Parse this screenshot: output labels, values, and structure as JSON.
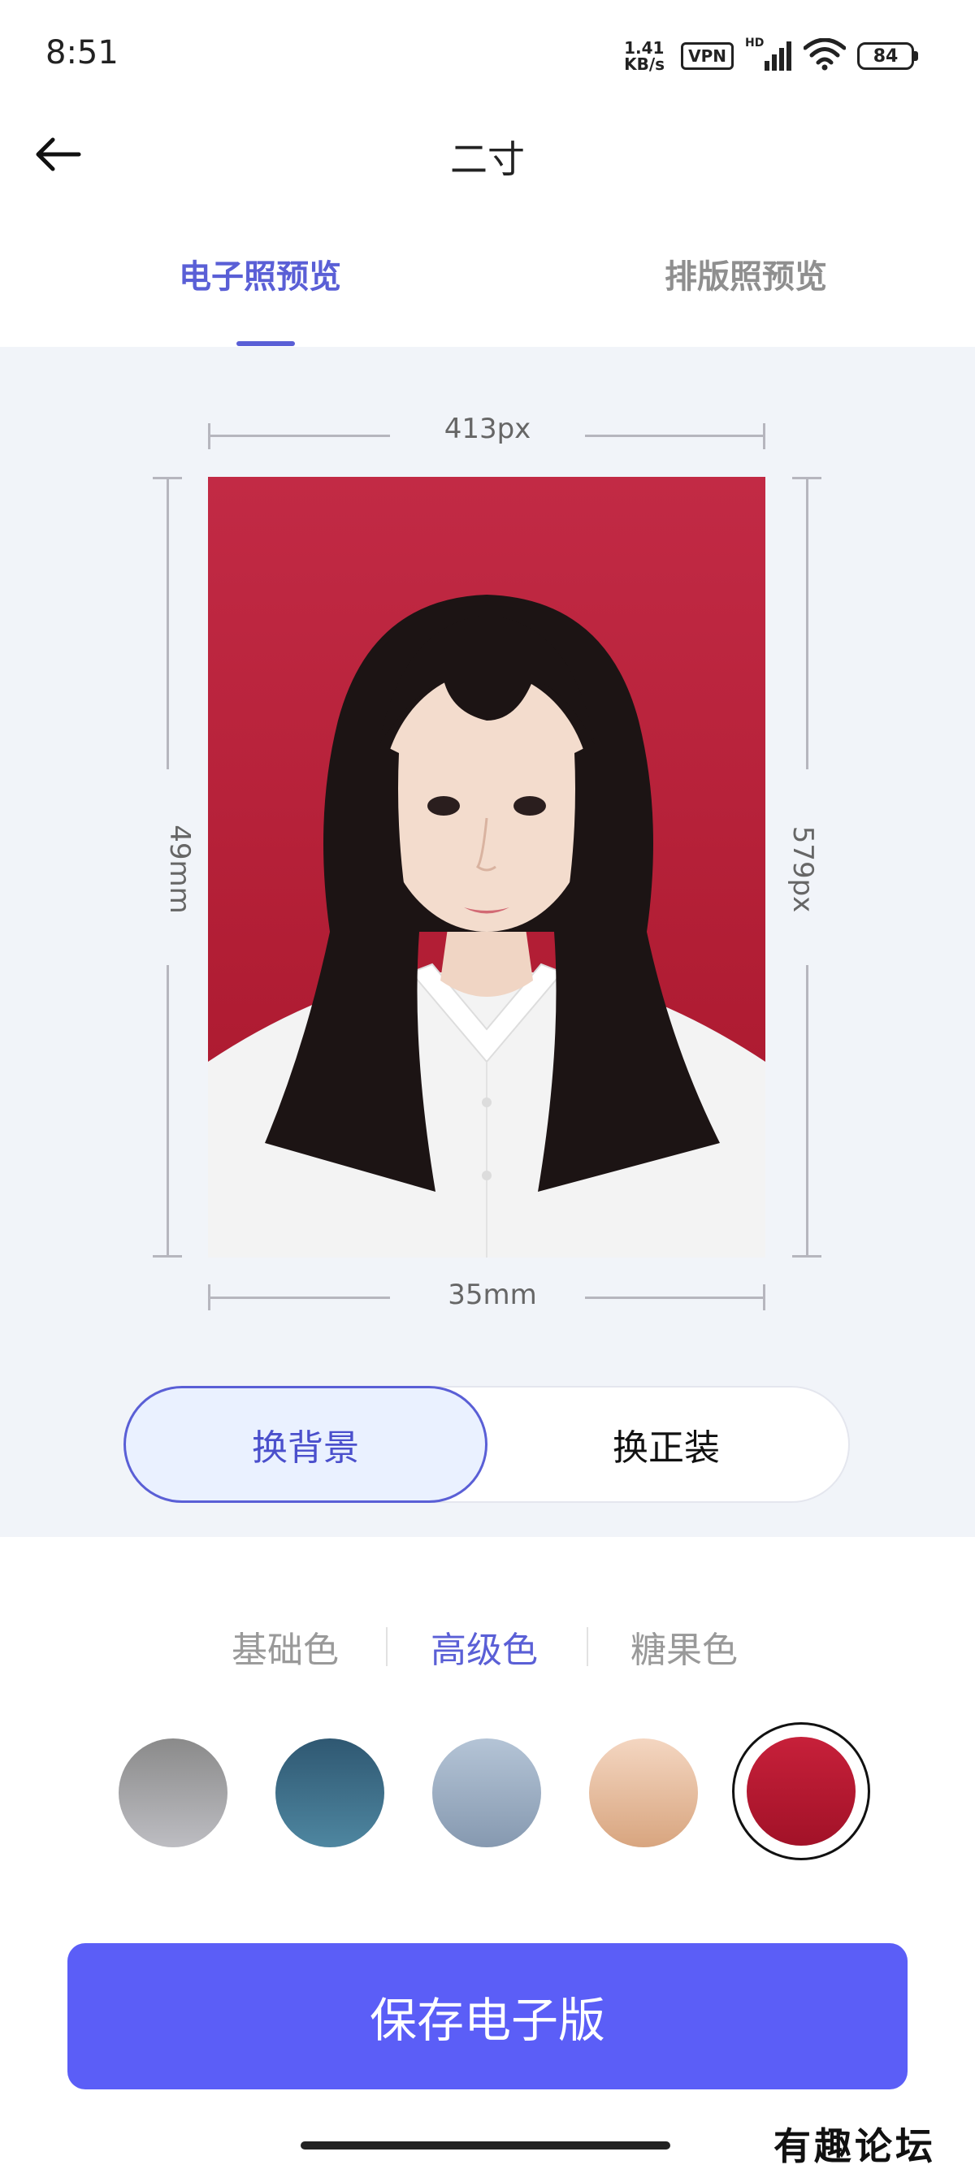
{
  "status_bar": {
    "time": "8:51",
    "net_speed_value": "1.41",
    "net_speed_unit": "KB/s",
    "vpn": "VPN",
    "hd": "HD",
    "battery": "84"
  },
  "nav": {
    "title": "二寸",
    "back_icon": "arrow-left-icon"
  },
  "tabs": {
    "electronic": "电子照预览",
    "layout": "排版照预览",
    "active": "electronic"
  },
  "dimensions": {
    "top_label": "413px",
    "bottom_label": "35mm",
    "left_label": "49mm",
    "right_label": "579px"
  },
  "mode_toggle": {
    "background": "换背景",
    "suit": "换正装",
    "active": "background"
  },
  "color_categories": {
    "basic": "基础色",
    "advanced": "高级色",
    "candy": "糖果色",
    "active": "advanced"
  },
  "swatches": [
    {
      "name": "gray",
      "color_top": "#8a8a8a",
      "color_bottom": "#bdbdc2"
    },
    {
      "name": "teal-blue",
      "color_top": "#2f5872",
      "color_bottom": "#4e86a0"
    },
    {
      "name": "light-steel-blue",
      "color_top": "#b4c4d6",
      "color_bottom": "#8699b0"
    },
    {
      "name": "peach",
      "color_top": "#f4d6c1",
      "color_bottom": "#d8a57f"
    },
    {
      "name": "red",
      "color_top": "#c7203a",
      "color_bottom": "#a21228",
      "selected": true
    }
  ],
  "save_button": "保存电子版",
  "photo_background": "#b8223a",
  "accent_color": "#5a5fd6",
  "button_color": "#5b5ef7",
  "watermark_text": "有趣论坛"
}
